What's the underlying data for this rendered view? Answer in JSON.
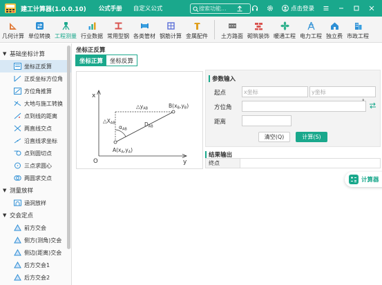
{
  "titlebar": {
    "app_title": "建工计算器(1.0.0.10)",
    "tabs": [
      {
        "label": "公式手册",
        "active": true
      },
      {
        "label": "自定义公式",
        "active": false
      }
    ],
    "search_placeholder": "搜索功能...",
    "login_label": "点击登录",
    "bg_color": "#1aa88c"
  },
  "toolbar": {
    "items": [
      {
        "label": "几何计算",
        "icon": "ruler-triangle-icon",
        "color": "#e07b39"
      },
      {
        "label": "单位转换",
        "icon": "unit-convert-icon",
        "color": "#2d8fd5"
      },
      {
        "label": "工程测量",
        "icon": "survey-icon",
        "color": "#1aa88c",
        "active": true
      },
      {
        "label": "行业数据",
        "icon": "bar-chart-icon",
        "color": "#3aa0e0"
      },
      {
        "label": "常用型钢",
        "icon": "steel-beam-icon",
        "color": "#d9534f"
      },
      {
        "label": "各类管材",
        "icon": "pipe-icon",
        "color": "#3aa0e0"
      },
      {
        "label": "钢筋计算",
        "icon": "rebar-icon",
        "color": "#5b6fd8"
      },
      {
        "label": "金属配件",
        "icon": "bolt-icon",
        "color": "#e0a020"
      },
      {
        "label": "土方路面",
        "icon": "road-icon",
        "color": "#777777"
      },
      {
        "label": "砌筑装饰",
        "icon": "brick-icon",
        "color": "#d9534f"
      },
      {
        "label": "暖通工程",
        "icon": "fan-icon",
        "color": "#2db08c"
      },
      {
        "label": "电力工程",
        "icon": "power-icon",
        "color": "#2d8fd5"
      },
      {
        "label": "独立费",
        "icon": "house-icon",
        "color": "#2d8fd5"
      },
      {
        "label": "市政工程",
        "icon": "building-icon",
        "color": "#2d8fd5"
      }
    ]
  },
  "sidebar": {
    "groups": [
      {
        "label": "基础坐标计算",
        "expanded": true,
        "items": [
          {
            "label": "坐标正反算",
            "icon": "coord-book-icon",
            "active": true
          },
          {
            "label": "正反坐标方位角",
            "icon": "azimuth-icon"
          },
          {
            "label": "方位角推算",
            "icon": "azimuth-calc-icon"
          },
          {
            "label": "大地与施工转换",
            "icon": "geodetic-convert-icon"
          },
          {
            "label": "点到线的距离",
            "icon": "point-line-icon"
          },
          {
            "label": "两直线交点",
            "icon": "line-intersect-icon"
          },
          {
            "label": "沿直线求坐标",
            "icon": "line-coord-icon"
          },
          {
            "label": "点到圆切点",
            "icon": "tangent-icon"
          },
          {
            "label": "三点求圆心",
            "icon": "circle-center-icon"
          },
          {
            "label": "两圆求交点",
            "icon": "circles-intersect-icon"
          }
        ]
      },
      {
        "label": "测量放样",
        "expanded": true,
        "items": [
          {
            "label": "涵洞放样",
            "icon": "culvert-icon"
          }
        ]
      },
      {
        "label": "交会定点",
        "expanded": true,
        "items": [
          {
            "label": "前方交会",
            "icon": "triangle-icon"
          },
          {
            "label": "侧方(测角)交会",
            "icon": "triangle-icon"
          },
          {
            "label": "侧边(距离)交会",
            "icon": "triangle-icon"
          },
          {
            "label": "后方交会1",
            "icon": "triangle-icon"
          },
          {
            "label": "后方交会2",
            "icon": "triangle-icon"
          }
        ]
      }
    ]
  },
  "main": {
    "section_title": "坐标正反算",
    "subtabs": [
      {
        "label": "坐标正算",
        "active": true
      },
      {
        "label": "坐标反算",
        "active": false
      }
    ],
    "diagram": {
      "axis_x": "x",
      "axis_y": "y",
      "origin": "O",
      "delta_y": "△y",
      "delta_y_sub": "AB",
      "delta_x": "△X",
      "delta_x_sub": "AB",
      "alpha": "α",
      "alpha_sub": "AB",
      "distance": "D",
      "distance_sub": "AB",
      "point_a": "A(x",
      "point_a_sub1": "A",
      "point_a_mid": ",y",
      "point_a_sub2": "A",
      "point_a_end": ")",
      "point_b": "B(x",
      "point_b_sub1": "B",
      "point_b_mid": ",y",
      "point_b_sub2": "B",
      "point_b_end": ")"
    },
    "params": {
      "title": "参数输入",
      "start_label": "起点",
      "x_placeholder": "x坐标",
      "y_placeholder": "y坐标",
      "azimuth_label": "方位角",
      "degree_symbol": "°",
      "distance_label": "距离",
      "clear_button": "清空(Q)",
      "calc_button": "计算(S)"
    },
    "result": {
      "title": "结果输出",
      "end_label": "终点",
      "end_value": ""
    },
    "calculator_label": "计算器"
  }
}
